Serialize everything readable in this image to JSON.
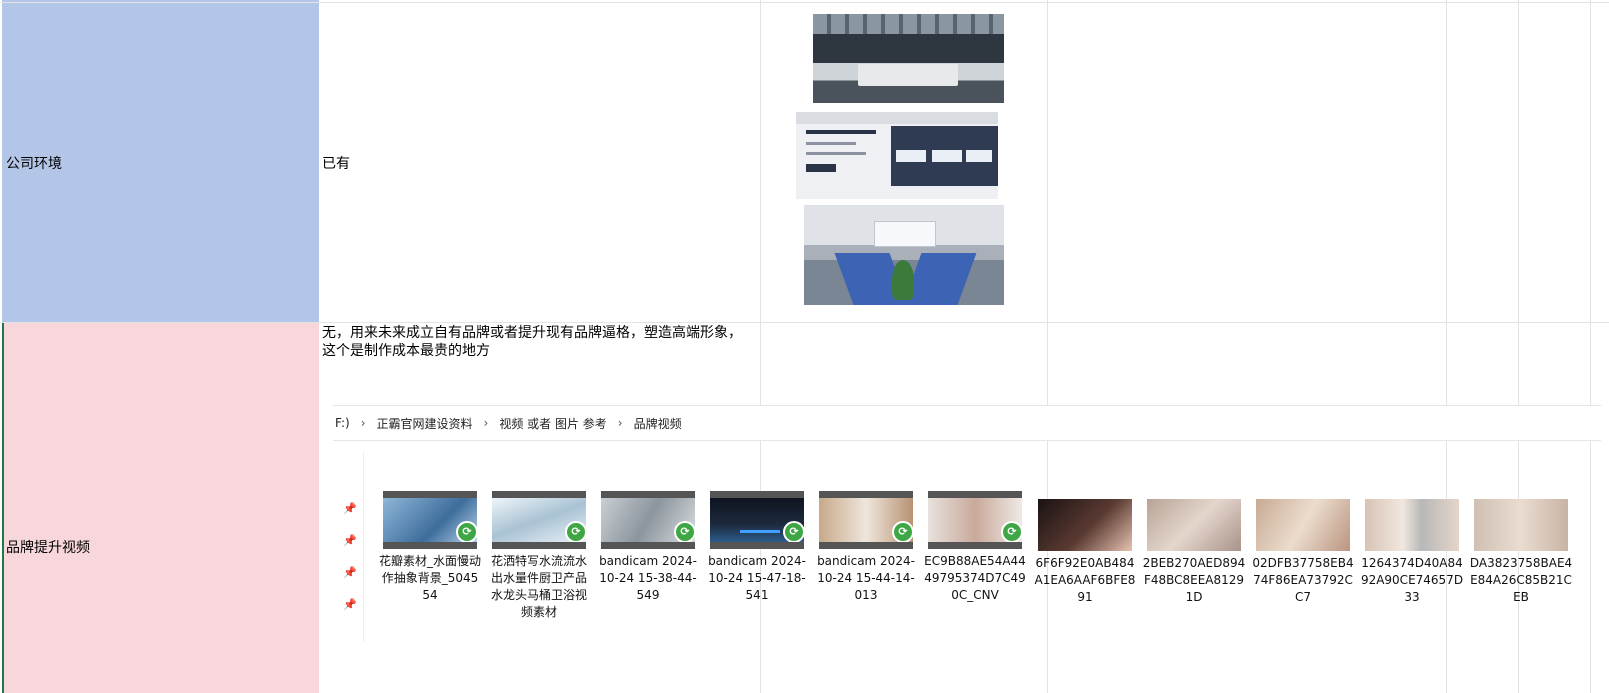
{
  "rows": [
    {
      "label": "公司环境",
      "value": "已有"
    },
    {
      "label": "品牌提升视频",
      "value": "无，用来未来成立自有品牌或者提升现有品牌逼格，塑造高端形象，这个是制作成本最贵的地方"
    }
  ],
  "colors": {
    "row1_bg": "#b4c6e7",
    "row2_bg": "#f8d7dc",
    "badge": "#3fa646"
  },
  "explorer": {
    "breadcrumb": [
      "F:)",
      "正霸官网建设资料",
      "视频 或者 图片 参考",
      "品牌视频"
    ],
    "items": [
      {
        "name": "花瓣素材_水面慢动作抽象背景_504554",
        "type": "video"
      },
      {
        "name": "花洒特写水流流水出水量件厨卫产品水龙头马桶卫浴视频素材",
        "type": "video"
      },
      {
        "name": "bandicam 2024-10-24 15-38-44-549",
        "type": "video"
      },
      {
        "name": "bandicam 2024-10-24 15-47-18-541",
        "type": "video"
      },
      {
        "name": "bandicam 2024-10-24 15-44-14-013",
        "type": "video"
      },
      {
        "name": "EC9B88AE54A4449795374D7C490C_CNV",
        "type": "video"
      },
      {
        "name": "6F6F92E0AB484A1EA6AAF6BFE891",
        "type": "image"
      },
      {
        "name": "2BEB270AED894F48BC8EEA81291D",
        "type": "image"
      },
      {
        "name": "02DFB37758EB474F86EA73792CC7",
        "type": "image"
      },
      {
        "name": "1264374D40A8492A90CE74657D33",
        "type": "image"
      },
      {
        "name": "DA3823758BAE4E84A26C85B21CEB",
        "type": "image"
      }
    ]
  }
}
